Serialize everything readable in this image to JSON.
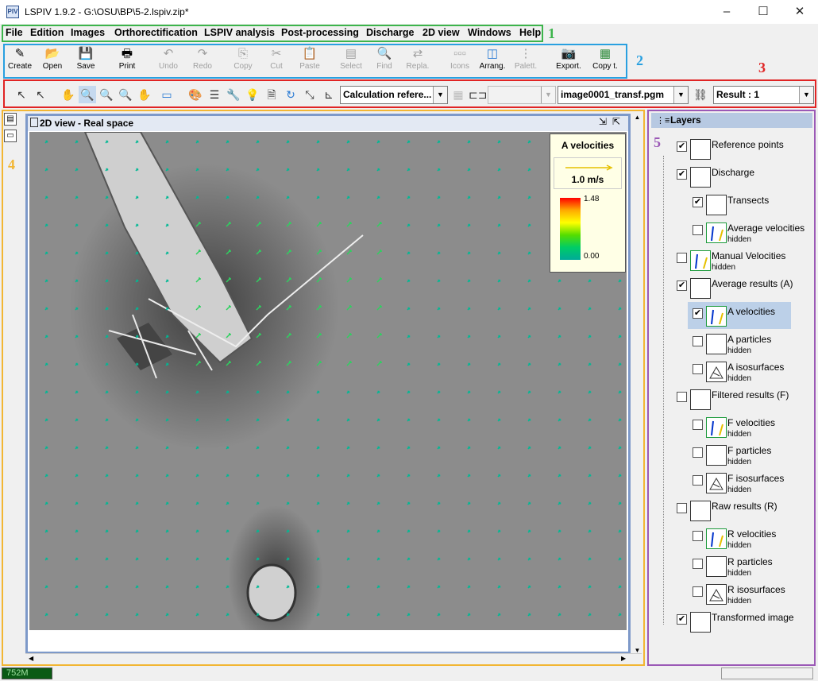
{
  "window": {
    "title": "LSPIV 1.9.2 - G:\\OSU\\BP\\5-2.lspiv.zip*",
    "app_icon": "PIV",
    "controls": {
      "minimize": "–",
      "maximize": "☐",
      "close": "✕"
    }
  },
  "menubar": {
    "items": [
      "File",
      "Edition",
      "Images",
      "Orthorectification",
      "LSPIV analysis",
      "Post-processing",
      "Discharge",
      "2D view",
      "Windows",
      "Help"
    ]
  },
  "annotations": {
    "n1": "1",
    "n2": "2",
    "n3": "3",
    "n4": "4",
    "n5": "5"
  },
  "toolbar1": {
    "buttons": [
      {
        "label": "Create",
        "icon": "✎"
      },
      {
        "label": "Open",
        "icon": "📂"
      },
      {
        "label": "Save",
        "icon": "💾"
      },
      {
        "label": "Print",
        "icon": "🖶"
      },
      {
        "label": "Undo",
        "icon": "↶"
      },
      {
        "label": "Redo",
        "icon": "↷"
      },
      {
        "label": "Copy",
        "icon": "⎘"
      },
      {
        "label": "Cut",
        "icon": "✂"
      },
      {
        "label": "Paste",
        "icon": "📋"
      },
      {
        "label": "Select",
        "icon": "▤"
      },
      {
        "label": "Find",
        "icon": "🔍"
      },
      {
        "label": "Repla.",
        "icon": "⇄"
      },
      {
        "label": "Icons",
        "icon": "▫▫▫"
      },
      {
        "label": "Arrang.",
        "icon": "◫"
      },
      {
        "label": "Palett.",
        "icon": "⋮"
      },
      {
        "label": "Export.",
        "icon": "📷"
      },
      {
        "label": "Copy t.",
        "icon": "▦"
      }
    ]
  },
  "toolbar2": {
    "tools": [
      "↖",
      "↖",
      "✋",
      "🔍",
      "🔍",
      "🔍",
      "✋",
      "▭",
      "🎨",
      "☰",
      "🔧",
      "💡",
      "🗎",
      "↻",
      "⤡",
      "⊾"
    ],
    "reference_combo": "Calculation refere...",
    "image_combo": "image0001_transf.pgm",
    "result_combo": "Result : 1",
    "link_icon": "⛓"
  },
  "view": {
    "title": "2D view - Real space"
  },
  "legend": {
    "title": "A velocities",
    "scale_label": "1.0 m/s",
    "max": "1.48",
    "min": "0.00"
  },
  "layers": {
    "title": "Layers",
    "items": [
      {
        "name": "Reference points",
        "checked": true,
        "hidden": ""
      },
      {
        "name": "Discharge",
        "checked": true,
        "hidden": ""
      },
      {
        "name": "Transects",
        "checked": true,
        "hidden": ""
      },
      {
        "name": "Average velocities",
        "checked": false,
        "hidden": "hidden"
      },
      {
        "name": "Manual Velocities",
        "checked": false,
        "hidden": "hidden"
      },
      {
        "name": "Average results (A)",
        "checked": true,
        "hidden": ""
      },
      {
        "name": "A velocities",
        "checked": true,
        "hidden": ""
      },
      {
        "name": "A particles",
        "checked": false,
        "hidden": "hidden"
      },
      {
        "name": "A isosurfaces",
        "checked": false,
        "hidden": "hidden"
      },
      {
        "name": "Filtered results (F)",
        "checked": false,
        "hidden": ""
      },
      {
        "name": "F velocities",
        "checked": false,
        "hidden": "hidden"
      },
      {
        "name": "F particles",
        "checked": false,
        "hidden": "hidden"
      },
      {
        "name": "F isosurfaces",
        "checked": false,
        "hidden": "hidden"
      },
      {
        "name": "Raw results (R)",
        "checked": false,
        "hidden": ""
      },
      {
        "name": "R velocities",
        "checked": false,
        "hidden": "hidden"
      },
      {
        "name": "R particles",
        "checked": false,
        "hidden": "hidden"
      },
      {
        "name": "R isosurfaces",
        "checked": false,
        "hidden": "hidden"
      },
      {
        "name": "Transformed image",
        "checked": true,
        "hidden": ""
      }
    ]
  },
  "status": {
    "memory": "752M"
  },
  "colors": {
    "menu_frame": "#3cb44b",
    "toolbar1_frame": "#29a0e0",
    "toolbar2_frame": "#e02424",
    "main_frame": "#f2b633",
    "layers_frame": "#9b59b6",
    "vector": "#00b894"
  }
}
